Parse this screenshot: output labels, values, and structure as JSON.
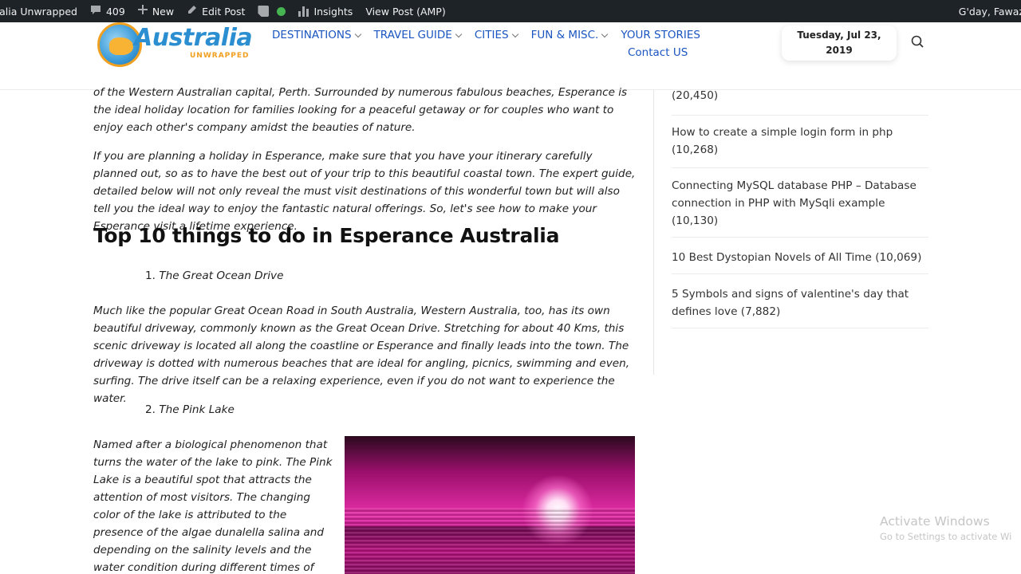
{
  "adminbar": {
    "site_name": "ralia Unwrapped",
    "comments_count": "409",
    "new_label": "New",
    "edit_post_label": "Edit Post",
    "insights_label": "Insights",
    "view_post_label": "View Post (AMP)",
    "greeting": "G'day, Fawaz"
  },
  "header": {
    "logo_text": "Australia",
    "logo_sub": "UNWRAPPED",
    "nav": [
      {
        "label": "DESTINATIONS"
      },
      {
        "label": "TRAVEL GUIDE"
      },
      {
        "label": "CITIES"
      },
      {
        "label": "FUN & MISC."
      },
      {
        "label": "YOUR STORIES"
      },
      {
        "label": "Contact US"
      }
    ],
    "date_line1": "Tuesday, Jul 23,",
    "date_line2": "2019",
    "colors": {
      "nav": "#1a55c0",
      "admin_bar": "#1d2327"
    }
  },
  "article": {
    "intro_para": "of the Western Australian capital, Perth. Surrounded by numerous fabulous beaches, Esperance is the ideal holiday location for families looking for a peaceful getaway or for couples who want to enjoy each other's company amidst the beauties of nature.",
    "plan_para": "If you are planning a holiday in Esperance, make sure that you have your itinerary carefully planned out, so as to have the best out of your trip to this beautiful coastal town. The expert guide, detailed below will not only reveal the must visit destinations of this wonderful town but will also tell you the ideal way to enjoy the fantastic natural offerings. So, let's see how to make your Esperance visit a lifetime experience.",
    "heading": "Top 10 things to do in Esperance Australia",
    "item1_number": "1.",
    "item1_title": "The Great Ocean Drive",
    "item1_para": "Much like the popular Great Ocean Road in South Australia, Western Australia, too, has its own beautiful driveway, commonly known as the Great Ocean Drive. Stretching for about 40 Kms, this scenic driveway is located all along the coastline or Esperance and finally leads into the town. The driveway is dotted with numerous beaches that are ideal for angling, picnics, swimming and even, surfing. The drive itself can be a relaxing experience, even if you do not want to experience the water.",
    "item2_number": "2.",
    "item2_title": "The Pink Lake",
    "item2_para": "Named after a biological phenomenon that turns the water of the lake to pink. The Pink Lake is a beautiful spot that attracts the attention of most visitors. The changing color of the lake is attributed to the presence of the algae dunalella salina and depending on the salinity levels and the water condition during different times of the day, the Lake"
  },
  "sidebar": {
    "items": [
      {
        "text": "(20,450)"
      },
      {
        "text": "How to create a simple login form in php (10,268)"
      },
      {
        "text": "Connecting MySQL database PHP – Database connection in PHP with MySqli example (10,130)"
      },
      {
        "text": "10 Best Dystopian Novels of All Time (10,069)"
      },
      {
        "text": "5 Symbols and signs of valentine's day that defines love (7,882)"
      }
    ]
  },
  "watermark": {
    "line1": "Activate Windows",
    "line2": "Go to Settings to activate Wi"
  }
}
